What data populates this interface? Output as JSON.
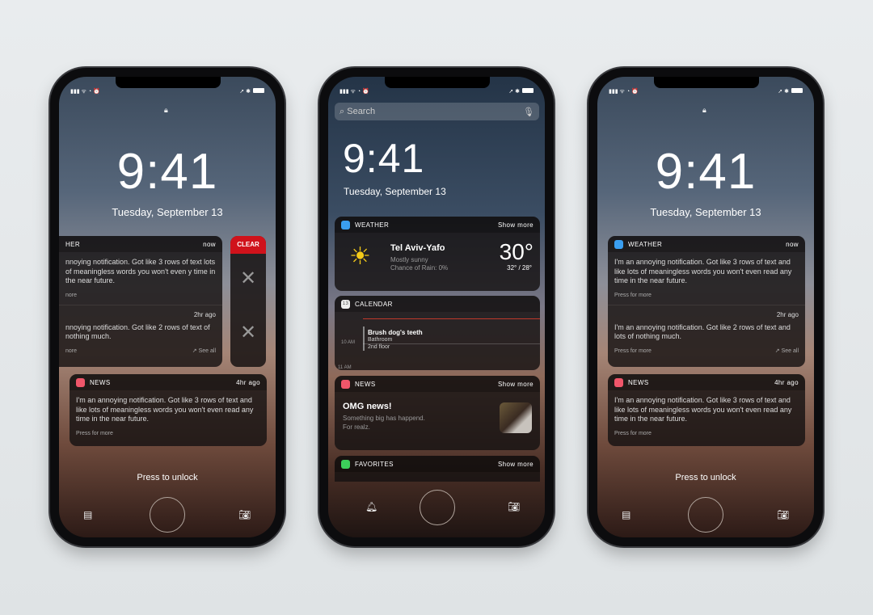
{
  "status": {
    "signal": "▮▮▮ ᯤ ◔ ⏰",
    "right": "➚ ✱"
  },
  "lock": {
    "time": "9:41",
    "date": "Tuesday, September 13",
    "unlock": "Press to unlock"
  },
  "left": {
    "weather_app": "HER",
    "weather_time": "now",
    "n1": "nnoying notification. Got like 3 rows of text lots of meaningless words you won't even y time in the near future.",
    "n1_more": "nore",
    "n2_time": "2hr ago",
    "n2": "nnoying notification. Got like 2 rows of text of nothing much.",
    "n2_more": "nore",
    "see_all": "See all",
    "clear": "CLEAR"
  },
  "notifs": {
    "weather_app": "WEATHER",
    "weather_time": "now",
    "n1": "I'm an annoying notification. Got like 3 rows of text and like lots of meaningless words you won't even read any time in the near future.",
    "press": "Press for more",
    "n2_time": "2hr ago",
    "n2": "I'm an annoying notification. Got like 2 rows of text and lots of nothing much.",
    "see_all": "See all",
    "news_app": "NEWS",
    "news_time": "4hr ago",
    "news": "I'm an annoying notification. Got like 3 rows of text and like lots of meaningless words you won't even read any time in the near future."
  },
  "today": {
    "search_placeholder": "Search",
    "show_more": "Show more",
    "weather": {
      "label": "WEATHER",
      "city": "Tel Aviv-Yafo",
      "cond": "Mostly sunny",
      "rain": "Chance of Rain: 0%",
      "temp": "30°",
      "range": "32° / 28°"
    },
    "calendar": {
      "label": "CALENDAR",
      "day": "13",
      "event": "Brush dog's teeth",
      "loc1": "Bathroom",
      "loc2": "2nd floor",
      "t1": "10 AM",
      "t2": "11 AM"
    },
    "news": {
      "label": "NEWS",
      "title": "OMG news!",
      "line1": "Something big has happend.",
      "line2": "For realz."
    },
    "favorites": {
      "label": "FAVORITES"
    }
  },
  "colors": {
    "clear": "#d0121b",
    "weather": "#3a9ef0",
    "news": "#f0566a",
    "phone": "#3ccf5a"
  }
}
